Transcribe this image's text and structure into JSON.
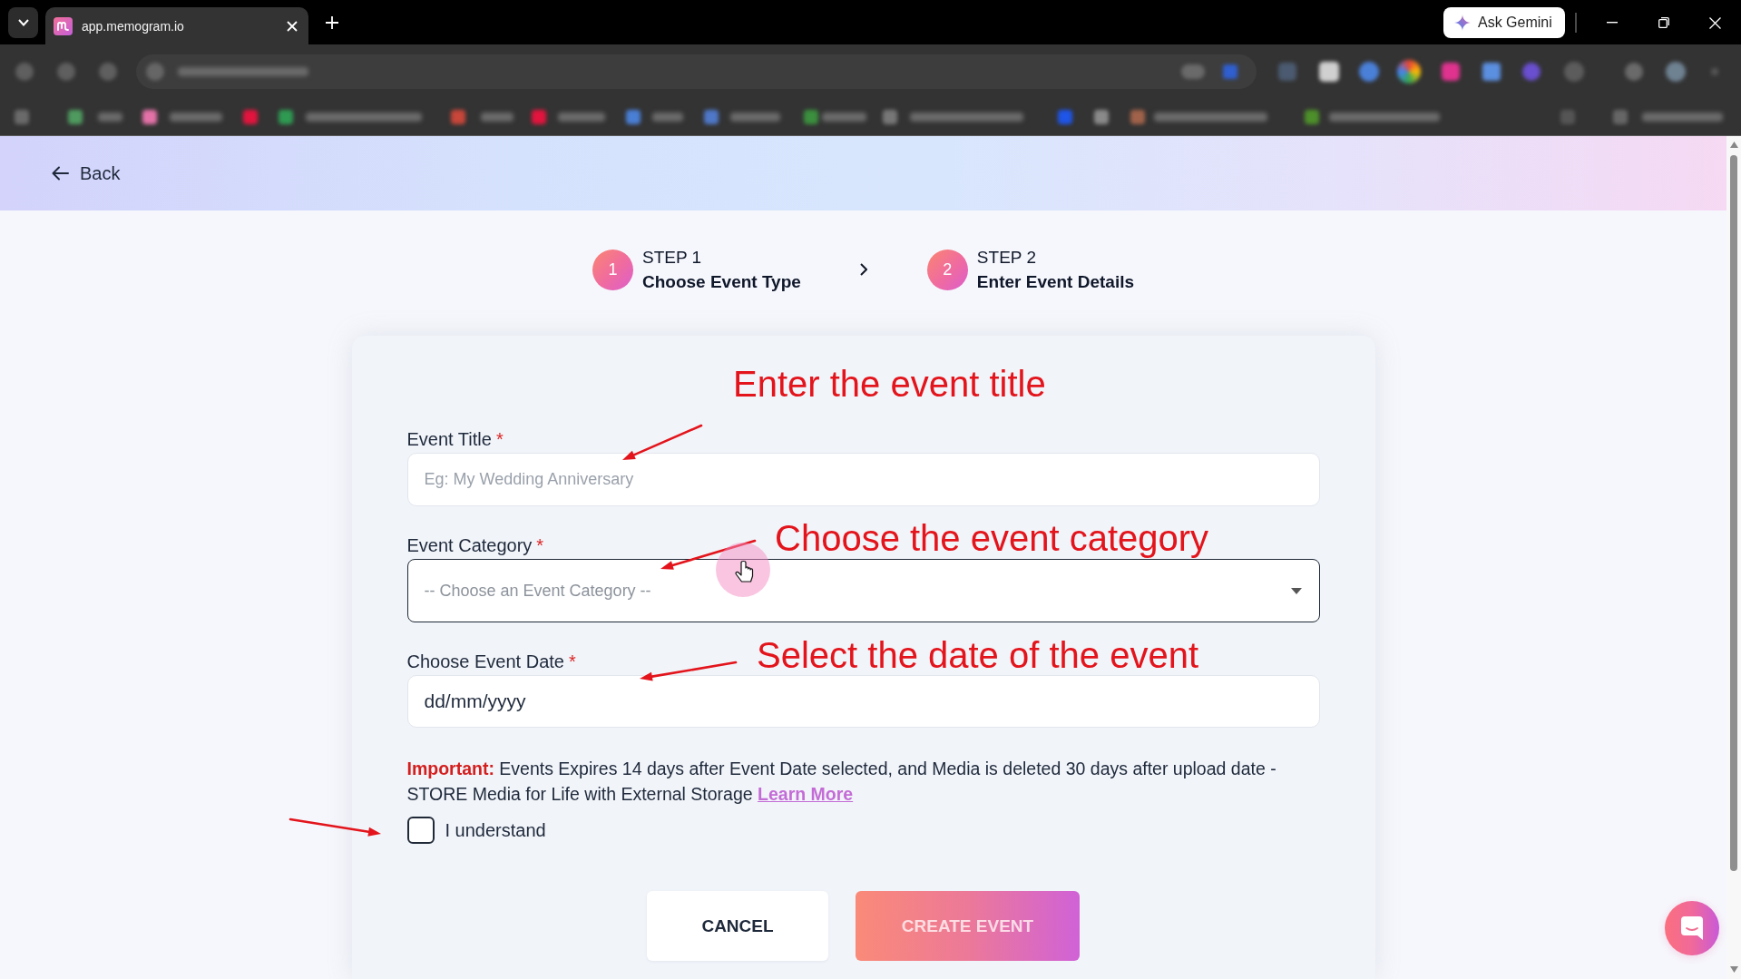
{
  "browser": {
    "tab": {
      "title": "app.memogram.io"
    },
    "ask_button": {
      "label": "Ask Gemini"
    }
  },
  "header": {
    "back_label": "Back"
  },
  "steps": [
    {
      "number": "1",
      "label": "STEP 1",
      "title": "Choose Event Type"
    },
    {
      "number": "2",
      "label": "STEP 2",
      "title": "Enter Event Details"
    }
  ],
  "annotations": [
    {
      "text": "Enter the event title"
    },
    {
      "text": "Choose the event category"
    },
    {
      "text": "Select the date of the event"
    }
  ],
  "form": {
    "fields": [
      {
        "kind": "text",
        "label": "Event Title",
        "required_mark": "*",
        "placeholder": "Eg: My Wedding Anniversary",
        "focused": false
      },
      {
        "kind": "select",
        "label": "Event Category",
        "required_mark": "*",
        "placeholder": "-- Choose an Event Category --",
        "focused": true
      },
      {
        "kind": "date",
        "label": "Choose Event Date",
        "required_mark": "*",
        "placeholder": "dd/mm/yyyy",
        "focused": false
      }
    ],
    "notice": {
      "lead": "Important:",
      "text": "Events Expires 14 days after Event Date selected, and Media is deleted 30 days after upload date - STORE Media for Life with External Storage",
      "link": "Learn More"
    },
    "acknowledge": {
      "label": "I understand",
      "checked": false
    },
    "buttons": [
      {
        "kind": "secondary",
        "label": "CANCEL",
        "disabled": false
      },
      {
        "kind": "primary",
        "label": "CREATE EVENT",
        "disabled": true
      }
    ]
  }
}
